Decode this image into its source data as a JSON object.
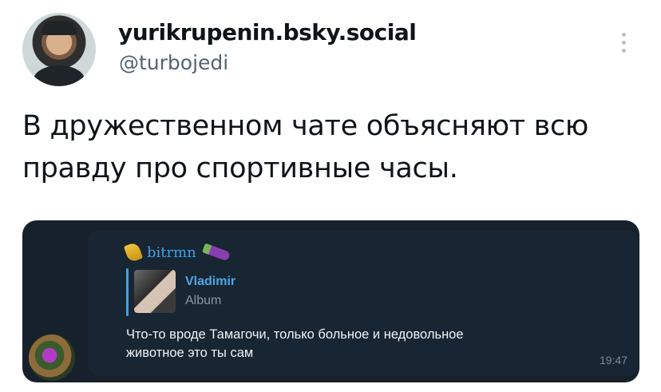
{
  "post": {
    "display_name": "yurikrupenin.bsky.social",
    "handle": "@turbojedi",
    "text_line1": "В дружественном чате объясняют всю",
    "text_line2": "правду про спортивные часы."
  },
  "chat": {
    "sender": "bitrmn",
    "reply_author": "Vladimir",
    "reply_type": "Album",
    "message_line1": "Что-то вроде Тамагочи, только больное и недовольное",
    "message_line2": "животное это ты сам",
    "time": "19:47"
  },
  "icons": {
    "more": "more-vertical-icon",
    "sender_left_emoji": "saxophone-emoji-icon",
    "sender_right_emoji": "eggplant-emoji-icon"
  },
  "colors": {
    "text": "#0f1419",
    "muted": "#536471",
    "chat_bg": "#17212b",
    "bubble_bg": "#182533",
    "accent": "#3fa1e5"
  }
}
